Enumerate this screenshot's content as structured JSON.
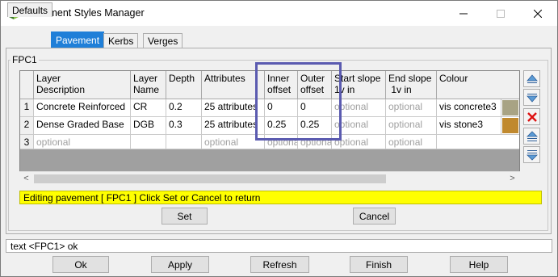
{
  "window": {
    "title": "Pavement Styles Manager"
  },
  "tabs": [
    "Defaults",
    "Pavement",
    "Kerbs",
    "Verges"
  ],
  "group": {
    "label": "FPC1"
  },
  "table": {
    "headers": [
      [
        "Layer",
        "Description"
      ],
      [
        "Layer",
        "Name"
      ],
      [
        "Depth",
        ""
      ],
      [
        "Attributes",
        ""
      ],
      [
        "Inner",
        "offset"
      ],
      [
        "Outer",
        "offset"
      ],
      [
        "Start slope",
        "1v in"
      ],
      [
        "End slope",
        " 1v in"
      ],
      [
        "Colour",
        ""
      ]
    ],
    "rows": [
      {
        "num": "1",
        "cells": [
          "Concrete Reinforced",
          "CR",
          "0.2",
          "25 attributes",
          "0",
          "0",
          "optional",
          "optional",
          "vis concrete3"
        ],
        "swatch": "#a8a384"
      },
      {
        "num": "2",
        "cells": [
          "Dense Graded Base",
          "DGB",
          "0.3",
          "25 attributes",
          "0.25",
          "0.25",
          "optional",
          "optional",
          "vis stone3"
        ],
        "swatch": "#c0892e"
      },
      {
        "num": "3",
        "cells": [
          "optional",
          "",
          "",
          "optional",
          "optional",
          "optional",
          "optional",
          "optional",
          ""
        ],
        "swatch": ""
      }
    ]
  },
  "status_message": "Editing pavement [ FPC1 ] Click Set or Cancel to return",
  "panel_buttons": {
    "set": "Set",
    "cancel": "Cancel"
  },
  "message_line": "text <FPC1> ok",
  "bottom_buttons": {
    "ok": "Ok",
    "apply": "Apply",
    "refresh": "Refresh",
    "finish": "Finish",
    "help": "Help"
  },
  "colors": {
    "active_tab": "#1f7fd8",
    "status_bar": "#ffff00",
    "highlight_box": "#5b5bb0"
  }
}
